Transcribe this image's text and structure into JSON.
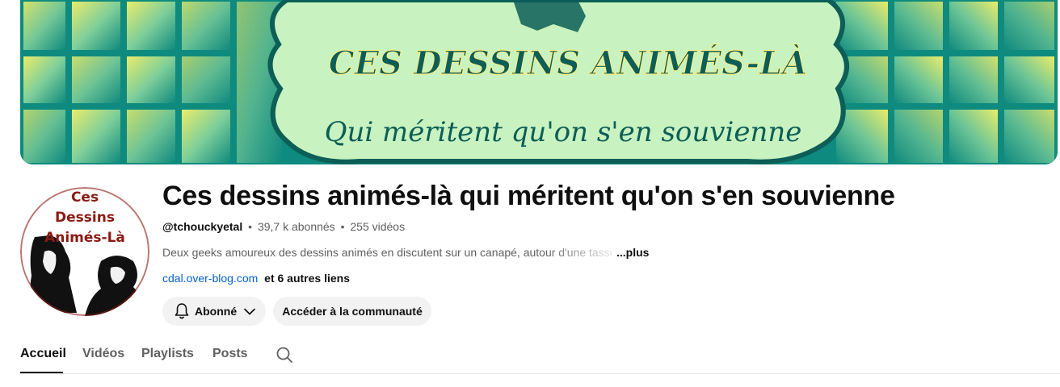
{
  "banner": {
    "title": "CES DESSINS ANIMÉS-LÀ",
    "subtitle": "Qui méritent qu'on s'en souvienne",
    "colors": {
      "teal": "#0f8a7e",
      "light_green": "#c8f2bf",
      "yellow": "#e9ec6a",
      "dark_teal": "#0c5e57"
    }
  },
  "avatar": {
    "line1": "Ces",
    "line2": "Dessins",
    "line3": "Animés-Là",
    "color": "#8b1a12"
  },
  "channel": {
    "title": "Ces dessins animés-là qui méritent qu'on s'en souvienne",
    "handle": "@tchouckyetal",
    "subscribers": "39,7 k abonnés",
    "videos": "255 vidéos",
    "separator": "•",
    "description": "Deux geeks amoureux des dessins animés en discutent sur un canapé, autour d'une tasse",
    "more": "...plus",
    "link": "cdal.over-blog.com",
    "more_links": "et 6 autres liens"
  },
  "buttons": {
    "subscribed": "Abonné",
    "community": "Accéder à la communauté"
  },
  "tabs": [
    {
      "label": "Accueil",
      "active": true
    },
    {
      "label": "Vidéos",
      "active": false
    },
    {
      "label": "Playlists",
      "active": false
    },
    {
      "label": "Posts",
      "active": false
    }
  ],
  "icons": {
    "bell": "bell-icon",
    "chevron": "chevron-down-icon",
    "search": "search-icon"
  }
}
